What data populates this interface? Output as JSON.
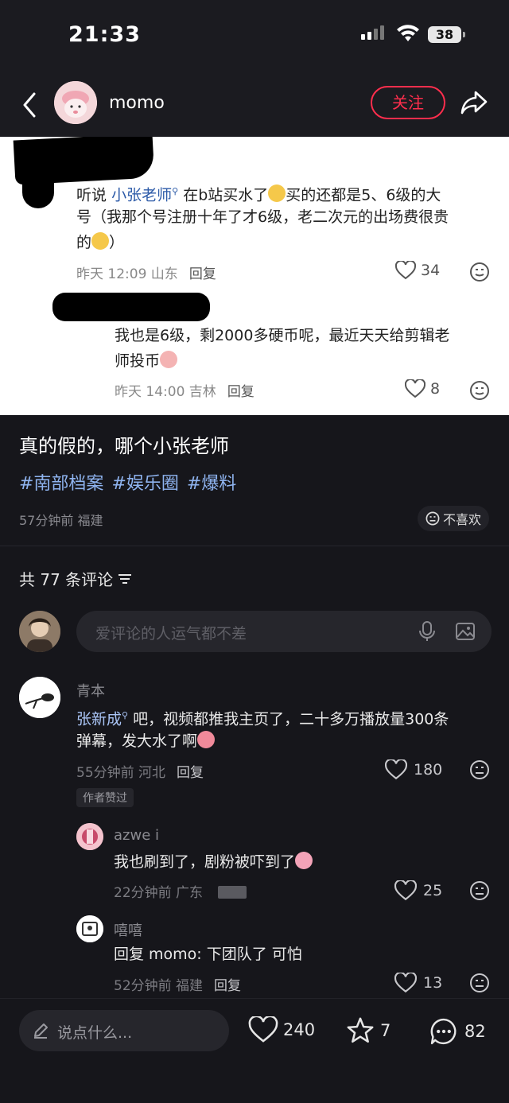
{
  "status_bar": {
    "time": "21:33",
    "battery": "38"
  },
  "header": {
    "author": "momo",
    "follow_label": "关注"
  },
  "screenshot": {
    "comment1": {
      "text_a": "听说",
      "mention": "小张老师",
      "text_b": " 在b站买水了",
      "text_c": "买的还都是5、6级的大",
      "line2": "号（我那个号注册十年了才6级，老二次元的出场费很贵",
      "line3": "的",
      "line3_end": "）",
      "time": "昨天 12:09 山东",
      "reply": "回复",
      "likes": "34"
    },
    "comment2": {
      "line1": "我也是6级，剩2000多硬币呢，最近天天给剪辑老",
      "line2": "师投币",
      "time": "昨天 14:00 吉林",
      "reply": "回复",
      "likes": "8"
    }
  },
  "post": {
    "title": "真的假的，哪个小张老师",
    "tags": [
      "#南部档案",
      "#娱乐圈",
      "#爆料"
    ],
    "meta": "57分钟前 福建",
    "dislike_label": "不喜欢"
  },
  "comments_header": {
    "count_label": "共 77 条评论"
  },
  "comment_input": {
    "placeholder": "爱评论的人运气都不差"
  },
  "comments": [
    {
      "name": "青本",
      "mention": "张新成",
      "text": " 吧，视频都推我主页了，二十多万播放量300条",
      "text2": "弹幕，发大水了啊",
      "time": "55分钟前 河北",
      "reply": "回复",
      "likes": "180",
      "badge": "作者赞过"
    },
    {
      "name": "azwe i",
      "text": "我也刷到了，剧粉被吓到了",
      "time": "22分钟前 广东",
      "likes": "25"
    },
    {
      "name": "嘻嘻",
      "text": "回复 momo: 下团队了   可怕",
      "time": "52分钟前 福建",
      "reply": "回复",
      "likes": "13"
    }
  ],
  "bottom_bar": {
    "placeholder": "说点什么...",
    "likes": "240",
    "stars": "7",
    "comments": "82"
  }
}
